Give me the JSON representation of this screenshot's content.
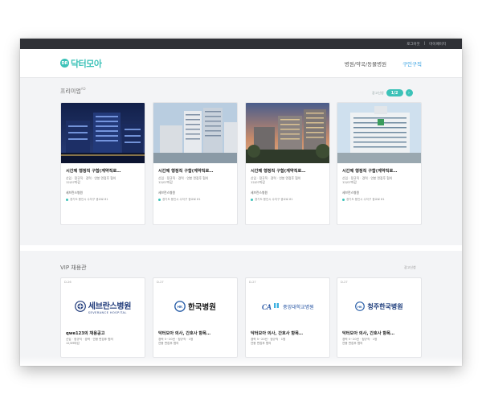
{
  "topbar": {
    "links": [
      "로그아웃",
      "|",
      "마이페이지"
    ]
  },
  "header": {
    "logo_badge": "DR",
    "logo_text": "닥터모아",
    "nav": [
      "병원/약국/동물병원",
      "구인구직"
    ]
  },
  "premium": {
    "title": "프리미엄",
    "sup": "AD",
    "pager_label": "광고신청",
    "pager": "1/2",
    "next_icon": "chevron-right-icon",
    "cards": [
      {
        "title": "시간제 행정직 구함(계약직로…",
        "meta1": "신입 · 정규직 · 경력 · 연봉 면접후 협의",
        "meta2": "12/07마감",
        "hospital": "세브란스병원",
        "location": "경기도 용인시 수지구 광교로 81"
      },
      {
        "title": "시간제 행정직 구함(계약직로…",
        "meta1": "신입 · 정규직 · 경력 · 연봉 면접후 협의",
        "meta2": "12/07마감",
        "hospital": "세브란스병원",
        "location": "경기도 용인시 수지구 광교로 81"
      },
      {
        "title": "시간제 행정직 구함(계약직로…",
        "meta1": "신입 · 정규직 · 경력 · 연봉 면접후 협의",
        "meta2": "12/07마감",
        "hospital": "세브란스병원",
        "location": "경기도 용인시 수지구 광교로 81"
      },
      {
        "title": "시간제 행정직 구함(계약직로…",
        "meta1": "신입 · 정규직 · 경력 · 연봉 면접후 협의",
        "meta2": "12/07마감",
        "hospital": "세브란스병원",
        "location": "경기도 용인시 수지구 광교로 81"
      }
    ]
  },
  "vip": {
    "title": "VIP 채용관",
    "ad_label": "광고신청",
    "cards": [
      {
        "dday": "D-26",
        "logo_name": "세브란스병원",
        "logo_sub": "SEVERANCE HOSPITAL",
        "title": "qwe123의 채용공고",
        "meta1": "신입 · 정규직 · 경력 · 연봉 면접후 협의",
        "meta2": "12/09마감"
      },
      {
        "dday": "D-27",
        "logo_name": "한국병원",
        "logo_sub": "",
        "title": "닥터모아 의사, 간호사 항목…",
        "meta1": "경력 5~20년 · 정규직 · 1명",
        "meta2": "연봉 면접후 협의"
      },
      {
        "dday": "D-27",
        "logo_name": "중앙대학교병원",
        "logo_sub": "",
        "title": "닥터모아 의사, 간호사 항목…",
        "meta1": "경력 5~20년 · 정규직 · 1명",
        "meta2": "연봉 면접후 협의"
      },
      {
        "dday": "D-27",
        "logo_name": "청주한국병원",
        "logo_sub": "",
        "title": "닥터모아 의사, 간호사 항목…",
        "meta1": "경력 5~20년 · 정규직 · 1명",
        "meta2": "연봉 면접후 협의"
      }
    ]
  },
  "colors": {
    "accent": "#3cc2b8",
    "nav_active": "#2f9de0",
    "topbar": "#2f3136"
  }
}
